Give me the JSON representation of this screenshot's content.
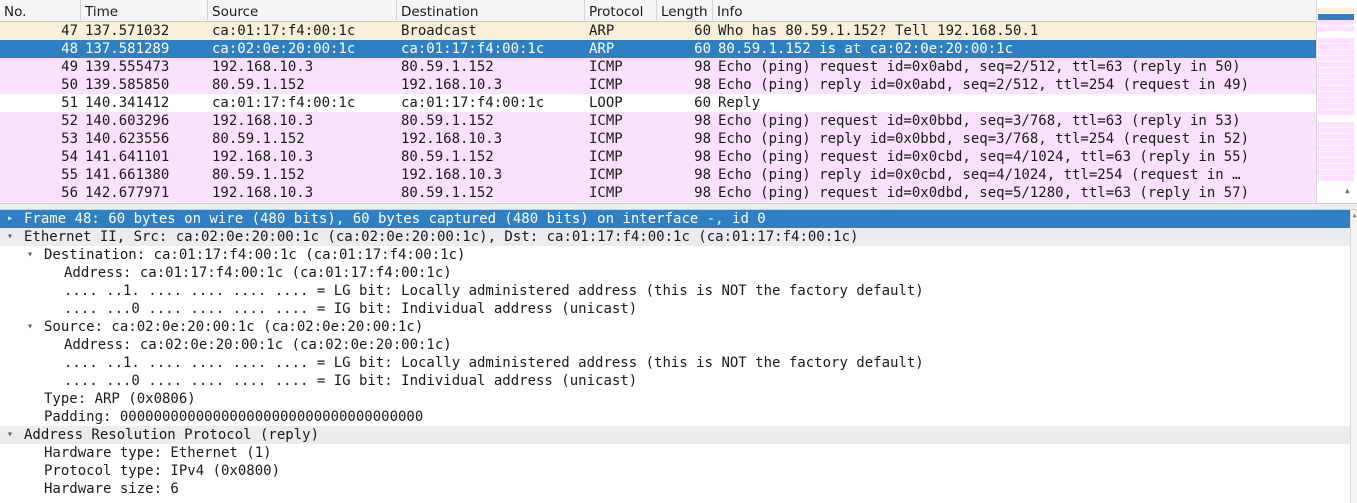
{
  "colors": {
    "selected": "#2f7fc4",
    "arp": "#faf0d7",
    "icmp": "#fce0ff",
    "loop": "#ffffff",
    "header": "#f5f5f5"
  },
  "packet_list": {
    "columns": [
      "No.",
      "Time",
      "Source",
      "Destination",
      "Protocol",
      "Length",
      "Info"
    ],
    "rows": [
      {
        "no": "47",
        "time": "137.571032",
        "source": "ca:01:17:f4:00:1c",
        "destination": "Broadcast",
        "protocol": "ARP",
        "length": "60",
        "info": "Who has 80.59.1.152? Tell 192.168.50.1",
        "kind": "arp"
      },
      {
        "no": "48",
        "time": "137.581289",
        "source": "ca:02:0e:20:00:1c",
        "destination": "ca:01:17:f4:00:1c",
        "protocol": "ARP",
        "length": "60",
        "info": "80.59.1.152 is at ca:02:0e:20:00:1c",
        "kind": "selected"
      },
      {
        "no": "49",
        "time": "139.555473",
        "source": "192.168.10.3",
        "destination": "80.59.1.152",
        "protocol": "ICMP",
        "length": "98",
        "info": "Echo (ping) request  id=0x0abd, seq=2/512, ttl=63 (reply in 50)",
        "kind": "icmp"
      },
      {
        "no": "50",
        "time": "139.585850",
        "source": "80.59.1.152",
        "destination": "192.168.10.3",
        "protocol": "ICMP",
        "length": "98",
        "info": "Echo (ping) reply    id=0x0abd, seq=2/512, ttl=254 (request in 49)",
        "kind": "icmp"
      },
      {
        "no": "51",
        "time": "140.341412",
        "source": "ca:01:17:f4:00:1c",
        "destination": "ca:01:17:f4:00:1c",
        "protocol": "LOOP",
        "length": "60",
        "info": "Reply",
        "kind": "loop"
      },
      {
        "no": "52",
        "time": "140.603296",
        "source": "192.168.10.3",
        "destination": "80.59.1.152",
        "protocol": "ICMP",
        "length": "98",
        "info": "Echo (ping) request  id=0x0bbd, seq=3/768, ttl=63 (reply in 53)",
        "kind": "icmp"
      },
      {
        "no": "53",
        "time": "140.623556",
        "source": "80.59.1.152",
        "destination": "192.168.10.3",
        "protocol": "ICMP",
        "length": "98",
        "info": "Echo (ping) reply    id=0x0bbd, seq=3/768, ttl=254 (request in 52)",
        "kind": "icmp"
      },
      {
        "no": "54",
        "time": "141.641101",
        "source": "192.168.10.3",
        "destination": "80.59.1.152",
        "protocol": "ICMP",
        "length": "98",
        "info": "Echo (ping) request  id=0x0cbd, seq=4/1024, ttl=63 (reply in 55)",
        "kind": "icmp"
      },
      {
        "no": "55",
        "time": "141.661380",
        "source": "80.59.1.152",
        "destination": "192.168.10.3",
        "protocol": "ICMP",
        "length": "98",
        "info": "Echo (ping) reply    id=0x0cbd, seq=4/1024, ttl=254 (request in …",
        "kind": "icmp"
      },
      {
        "no": "56",
        "time": "142.677971",
        "source": "192.168.10.3",
        "destination": "80.59.1.152",
        "protocol": "ICMP",
        "length": "98",
        "info": "Echo (ping) request  id=0x0dbd, seq=5/1280, ttl=63 (reply in 57)",
        "kind": "icmp"
      }
    ]
  },
  "details": {
    "rows": [
      {
        "text": "Frame 48: 60 bytes on wire (480 bits), 60 bytes captured (480 bits) on interface -, id 0",
        "level": 0,
        "toggle": "collapsed",
        "style": "sel"
      },
      {
        "text": "Ethernet II, Src: ca:02:0e:20:00:1c (ca:02:0e:20:00:1c), Dst: ca:01:17:f4:00:1c (ca:01:17:f4:00:1c)",
        "level": 0,
        "toggle": "expanded",
        "style": "hdr"
      },
      {
        "text": "Destination: ca:01:17:f4:00:1c (ca:01:17:f4:00:1c)",
        "level": 1,
        "toggle": "expanded",
        "style": ""
      },
      {
        "text": "Address: ca:01:17:f4:00:1c (ca:01:17:f4:00:1c)",
        "level": 2,
        "toggle": "",
        "style": ""
      },
      {
        "text": ".... ..1. .... .... .... .... = LG bit: Locally administered address (this is NOT the factory default)",
        "level": 2,
        "toggle": "",
        "style": ""
      },
      {
        "text": ".... ...0 .... .... .... .... = IG bit: Individual address (unicast)",
        "level": 2,
        "toggle": "",
        "style": ""
      },
      {
        "text": "Source: ca:02:0e:20:00:1c (ca:02:0e:20:00:1c)",
        "level": 1,
        "toggle": "expanded",
        "style": ""
      },
      {
        "text": "Address: ca:02:0e:20:00:1c (ca:02:0e:20:00:1c)",
        "level": 2,
        "toggle": "",
        "style": ""
      },
      {
        "text": ".... ..1. .... .... .... .... = LG bit: Locally administered address (this is NOT the factory default)",
        "level": 2,
        "toggle": "",
        "style": ""
      },
      {
        "text": ".... ...0 .... .... .... .... = IG bit: Individual address (unicast)",
        "level": 2,
        "toggle": "",
        "style": ""
      },
      {
        "text": "Type: ARP (0x0806)",
        "level": 1,
        "toggle": "",
        "style": ""
      },
      {
        "text": "Padding: 000000000000000000000000000000000000",
        "level": 1,
        "toggle": "",
        "style": ""
      },
      {
        "text": "Address Resolution Protocol (reply)",
        "level": 0,
        "toggle": "expanded",
        "style": "hdr"
      },
      {
        "text": "Hardware type: Ethernet (1)",
        "level": 1,
        "toggle": "",
        "style": ""
      },
      {
        "text": "Protocol type: IPv4 (0x0800)",
        "level": 1,
        "toggle": "",
        "style": ""
      },
      {
        "text": "Hardware size: 6",
        "level": 1,
        "toggle": "",
        "style": ""
      }
    ]
  },
  "icons": {
    "collapsed": "▸",
    "expanded": "▾",
    "scroll_up": "▲"
  }
}
